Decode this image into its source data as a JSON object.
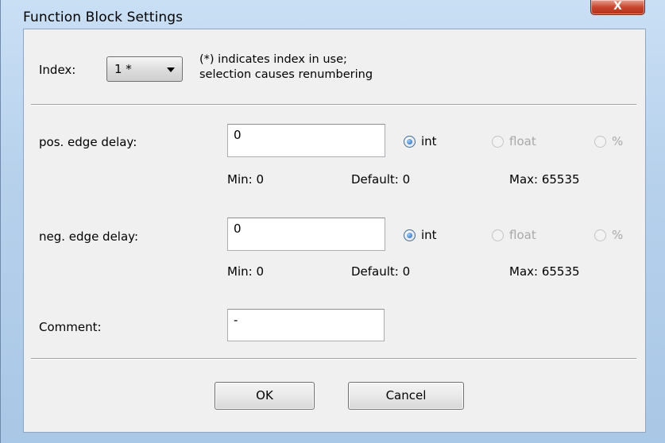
{
  "window": {
    "title": "Function Block Settings",
    "close_label": "X"
  },
  "index": {
    "label": "Index:",
    "selected": "1 *",
    "note_line1": "(*) indicates index in use;",
    "note_line2": "selection causes renumbering"
  },
  "pos_edge": {
    "label": "pos. edge delay:",
    "value": "0",
    "options": [
      "int",
      "float",
      "%"
    ],
    "selected_option": "int",
    "min": "Min: 0",
    "default": "Default: 0",
    "max": "Max: 65535"
  },
  "neg_edge": {
    "label": "neg. edge delay:",
    "value": "0",
    "options": [
      "int",
      "float",
      "%"
    ],
    "selected_option": "int",
    "min": "Min: 0",
    "default": "Default: 0",
    "max": "Max: 65535"
  },
  "comment": {
    "label": "Comment:",
    "value": "-"
  },
  "buttons": {
    "ok": "OK",
    "cancel": "Cancel"
  },
  "colors": {
    "frame": "#b7d1ec",
    "dialog_bg": "#f0f0f0",
    "close_red": "#c7462d",
    "disabled_text": "#a8a8a8"
  }
}
